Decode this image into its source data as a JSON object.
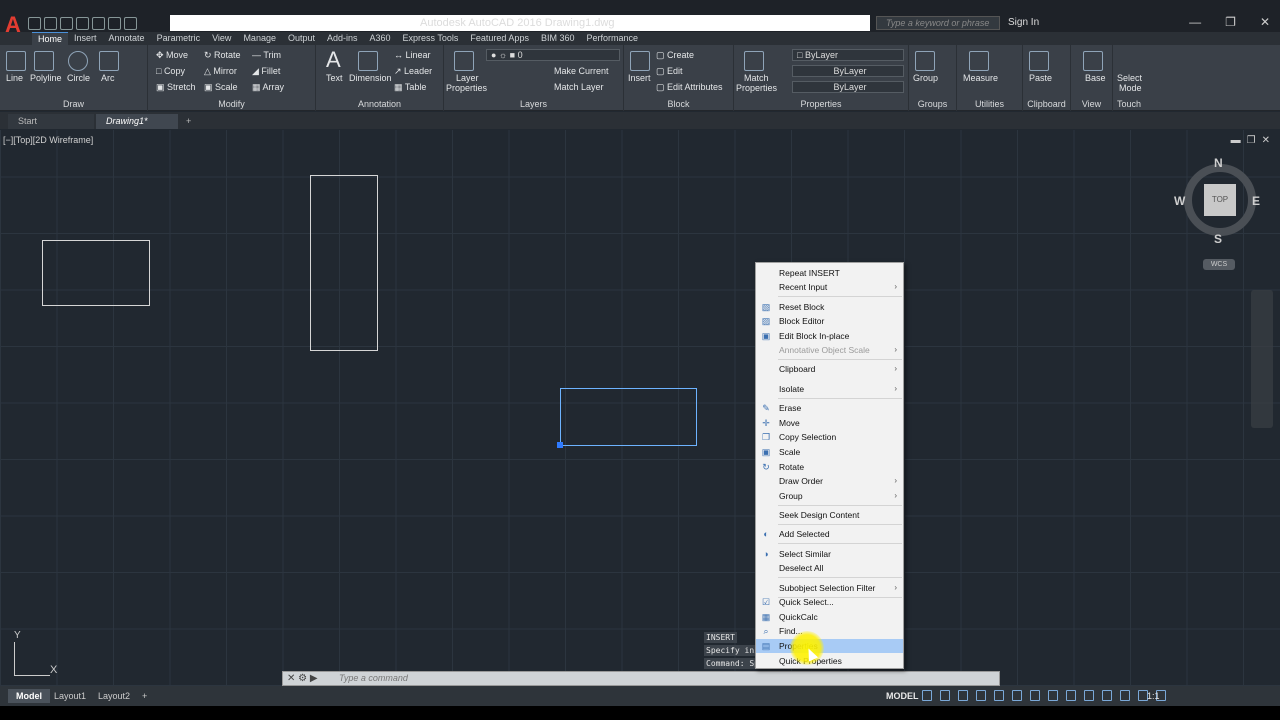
{
  "app": {
    "title": "Autodesk AutoCAD 2016   Drawing1.dwg",
    "logo": "A",
    "search_placeholder": "Type a keyword or phrase",
    "sign_in": "Sign In"
  },
  "ribbon_tabs": [
    "Home",
    "Insert",
    "Annotate",
    "Parametric",
    "View",
    "Manage",
    "Output",
    "Add-ins",
    "A360",
    "Express Tools",
    "Featured Apps",
    "BIM 360",
    "Performance"
  ],
  "ribbon": {
    "draw": {
      "title": "Draw",
      "line": "Line",
      "polyline": "Polyline",
      "circle": "Circle",
      "arc": "Arc"
    },
    "modify": {
      "title": "Modify",
      "move": "Move",
      "rotate": "Rotate",
      "trim": "Trim",
      "copy": "Copy",
      "mirror": "Mirror",
      "fillet": "Fillet",
      "stretch": "Stretch",
      "scale": "Scale",
      "array": "Array"
    },
    "annotation": {
      "title": "Annotation",
      "text": "Text",
      "dimension": "Dimension",
      "linear": "Linear",
      "leader": "Leader",
      "table": "Table"
    },
    "layers": {
      "title": "Layers",
      "layer_properties_1": "Layer",
      "layer_properties_2": "Properties",
      "layer_value": "0",
      "make_current": "Make Current",
      "match_layer": "Match Layer"
    },
    "block": {
      "title": "Block",
      "insert": "Insert",
      "create": "Create",
      "edit": "Edit",
      "edit_attributes": "Edit Attributes"
    },
    "properties": {
      "title": "Properties",
      "match_1": "Match",
      "match_2": "Properties",
      "color": "ByLayer",
      "linetype": "ByLayer",
      "lineweight": "ByLayer"
    },
    "groups": {
      "title": "Groups",
      "group": "Group"
    },
    "utilities": {
      "title": "Utilities",
      "measure": "Measure"
    },
    "clipboard": {
      "title": "Clipboard",
      "paste": "Paste"
    },
    "view": {
      "title": "View",
      "base": "Base"
    },
    "touch": {
      "title": "Touch",
      "select_1": "Select",
      "select_2": "Mode"
    }
  },
  "doc_tabs": {
    "start": "Start",
    "drawing": "Drawing1*"
  },
  "viewport_label": "[−][Top][2D Wireframe]",
  "viewcube": {
    "top": "TOP",
    "n": "N",
    "s": "S",
    "e": "E",
    "w": "W",
    "wcs": "WCS"
  },
  "ucs": {
    "x": "X",
    "y": "Y"
  },
  "command": {
    "history_1": "INSERT",
    "history_2": "Specify ins                        :/X/Y/Z/Rotate]:",
    "history_3": "Command: Sp                        /WPolygon/CPolygon]:",
    "placeholder": "Type a command"
  },
  "context_menu": [
    {
      "label": "Repeat INSERT",
      "icon": "",
      "submenu": false,
      "disabled": false
    },
    {
      "label": "Recent Input",
      "icon": "",
      "submenu": true,
      "disabled": false
    },
    {
      "label": "Reset Block",
      "icon": "reset-block-icon",
      "submenu": false,
      "disabled": false
    },
    {
      "label": "Block Editor",
      "icon": "block-editor-icon",
      "submenu": false,
      "disabled": false
    },
    {
      "label": "Edit Block In-place",
      "icon": "edit-inplace-icon",
      "submenu": false,
      "disabled": false
    },
    {
      "label": "Annotative Object Scale",
      "icon": "",
      "submenu": true,
      "disabled": true
    },
    {
      "label": "Clipboard",
      "icon": "",
      "submenu": true,
      "disabled": false
    },
    {
      "label": "Isolate",
      "icon": "",
      "submenu": true,
      "disabled": false
    },
    {
      "label": "Erase",
      "icon": "erase-icon",
      "submenu": false,
      "disabled": false
    },
    {
      "label": "Move",
      "icon": "move-icon",
      "submenu": false,
      "disabled": false
    },
    {
      "label": "Copy Selection",
      "icon": "copy-icon",
      "submenu": false,
      "disabled": false
    },
    {
      "label": "Scale",
      "icon": "scale-icon",
      "submenu": false,
      "disabled": false
    },
    {
      "label": "Rotate",
      "icon": "rotate-icon",
      "submenu": false,
      "disabled": false
    },
    {
      "label": "Draw Order",
      "icon": "",
      "submenu": true,
      "disabled": false
    },
    {
      "label": "Group",
      "icon": "",
      "submenu": true,
      "disabled": false
    },
    {
      "label": "Seek Design Content",
      "icon": "",
      "submenu": false,
      "disabled": false
    },
    {
      "label": "Add Selected",
      "icon": "add-selected-icon",
      "submenu": false,
      "disabled": false
    },
    {
      "label": "Select Similar",
      "icon": "select-similar-icon",
      "submenu": false,
      "disabled": false
    },
    {
      "label": "Deselect All",
      "icon": "",
      "submenu": false,
      "disabled": false
    },
    {
      "label": "Subobject Selection Filter",
      "icon": "",
      "submenu": true,
      "disabled": false
    },
    {
      "label": "Quick Select...",
      "icon": "quick-select-icon",
      "submenu": false,
      "disabled": false
    },
    {
      "label": "QuickCalc",
      "icon": "quickcalc-icon",
      "submenu": false,
      "disabled": false
    },
    {
      "label": "Find...",
      "icon": "find-icon",
      "submenu": false,
      "disabled": false
    },
    {
      "label": "Properties",
      "icon": "properties-icon",
      "submenu": false,
      "disabled": false,
      "highlighted": true
    },
    {
      "label": "Quick Properties",
      "icon": "",
      "submenu": false,
      "disabled": false
    }
  ],
  "status": {
    "model_tab": "Model",
    "layout1": "Layout1",
    "layout2": "Layout2",
    "add": "+",
    "model": "MODEL",
    "scale": "1:1"
  }
}
